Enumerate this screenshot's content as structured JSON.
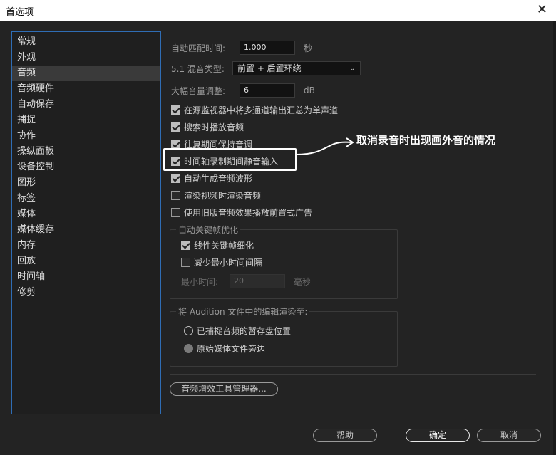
{
  "window": {
    "title": "首选项",
    "close_glyph": "✕"
  },
  "sidebar": {
    "items": [
      "常规",
      "外观",
      "音频",
      "音频硬件",
      "自动保存",
      "捕捉",
      "协作",
      "操纵面板",
      "设备控制",
      "图形",
      "标签",
      "媒体",
      "媒体缓存",
      "内存",
      "回放",
      "时间轴",
      "修剪"
    ],
    "selected_index": 2
  },
  "audio": {
    "auto_match_label": "自动匹配时间:",
    "auto_match_value": "1.000",
    "auto_match_unit": "秒",
    "mix_label": "5.1 混音类型:",
    "mix_value": "前置 + 后置环绕",
    "mix_chevron": "⌄",
    "volume_label": "大幅音量调整:",
    "volume_value": "6",
    "volume_unit": "dB",
    "checkboxes": [
      {
        "label": "在源监视器中将多通道输出汇总为单声道",
        "checked": true
      },
      {
        "label": "搜索时播放音频",
        "checked": true
      },
      {
        "label": "往复期间保持音调",
        "checked": true
      },
      {
        "label": "时间轴录制期间静音输入",
        "checked": true
      },
      {
        "label": "自动生成音频波形",
        "checked": true
      },
      {
        "label": "渲染视频时渲染音频",
        "checked": false
      },
      {
        "label": "使用旧版音频效果播放前置式广告",
        "checked": false
      }
    ]
  },
  "keyframe_group": {
    "legend": "自动关键帧优化",
    "linear_label": "线性关键帧细化",
    "linear_checked": true,
    "reduce_label": "减少最小时间间隔",
    "reduce_checked": false,
    "min_time_label": "最小时间:",
    "min_time_value": "20",
    "min_time_unit": "毫秒"
  },
  "audition_group": {
    "legend": "将 Audition 文件中的编辑渲染至:",
    "option1": "已捕捉音频的暂存盘位置",
    "option2": "原始媒体文件旁边"
  },
  "annotation": {
    "text": "取消录音时出现画外音的情况"
  },
  "buttons": {
    "plugin_manager": "音频增效工具管理器...",
    "help": "帮助",
    "ok": "确定",
    "cancel": "取消"
  }
}
